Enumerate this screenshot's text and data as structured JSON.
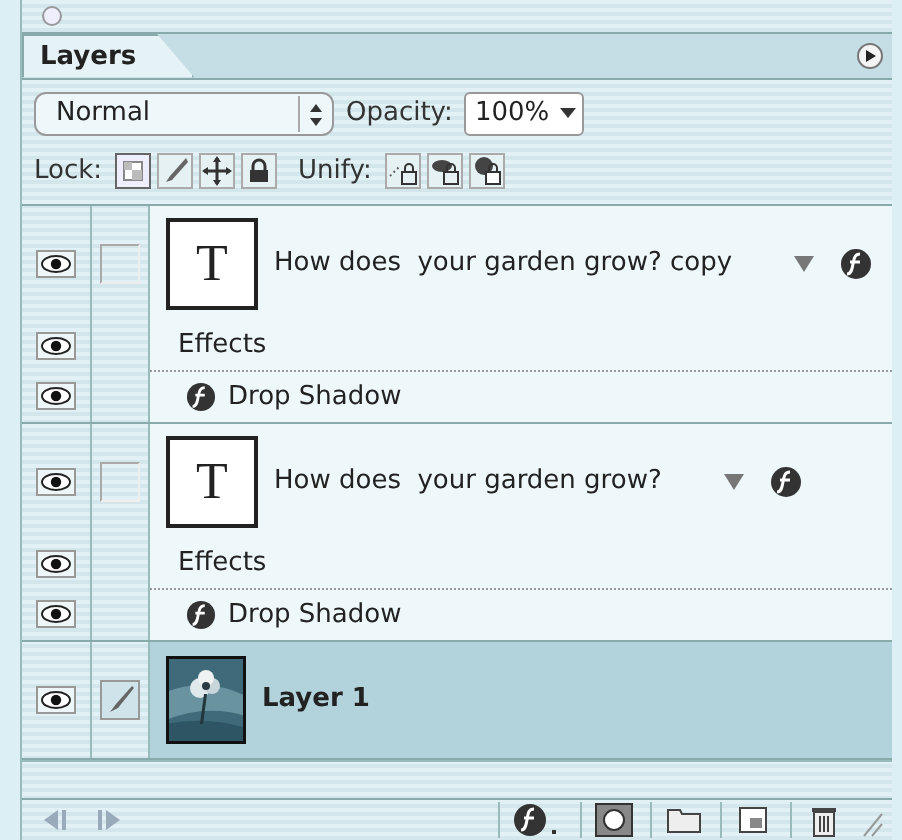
{
  "panel": {
    "tab": "Layers"
  },
  "blend_mode": "Normal",
  "opacity": {
    "label": "Opacity:",
    "value": "100%"
  },
  "lock": {
    "label": "Lock:"
  },
  "unify": {
    "label": "Unify:"
  },
  "layers": [
    {
      "kind": "text",
      "thumb": "T",
      "name": "How does  your garden grow? copy",
      "visible": true,
      "selected": false,
      "effects_label": "Effects",
      "effects_visible": true,
      "effects": [
        {
          "name": "Drop Shadow",
          "visible": true
        }
      ]
    },
    {
      "kind": "text",
      "thumb": "T",
      "name": "How does  your garden grow?",
      "visible": true,
      "selected": false,
      "effects_label": "Effects",
      "effects_visible": true,
      "effects": [
        {
          "name": "Drop Shadow",
          "visible": true
        }
      ]
    },
    {
      "name": "Layer 1",
      "visible": true,
      "selected": true
    }
  ]
}
